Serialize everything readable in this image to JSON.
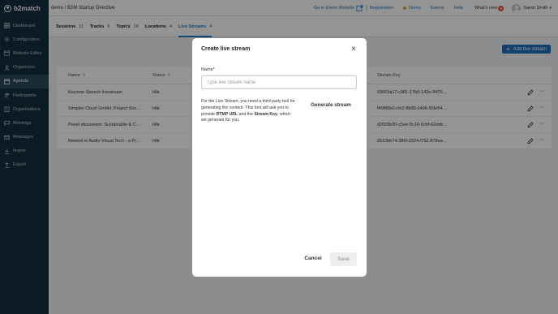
{
  "app": {
    "logo_text": "b2match"
  },
  "sidebar": {
    "items": [
      {
        "label": "Dashboard",
        "icon": "dashboard-icon",
        "active": false
      },
      {
        "label": "Configuration",
        "icon": "configuration-icon",
        "active": false
      },
      {
        "label": "Website Editor",
        "icon": "website-editor-icon",
        "active": false
      },
      {
        "label": "Organizers",
        "icon": "organizers-icon",
        "active": false
      },
      {
        "label": "Agenda",
        "icon": "agenda-icon",
        "active": true
      },
      {
        "label": "Participants",
        "icon": "participants-icon",
        "active": false
      },
      {
        "label": "Organisations",
        "icon": "organisations-icon",
        "active": false
      },
      {
        "label": "Meetings",
        "icon": "meetings-icon",
        "active": false
      },
      {
        "label": "Messages",
        "icon": "messages-icon",
        "active": false
      },
      {
        "label": "Import",
        "icon": "import-icon",
        "active": false
      },
      {
        "label": "Export",
        "icon": "export-icon",
        "active": false
      }
    ]
  },
  "header": {
    "breadcrumb": "demo / B2M Startup Directive",
    "goto_website": "Go to Event Website",
    "separator": "|",
    "registration": "Registration",
    "demo": "Demo",
    "events": "Events",
    "help": "Help",
    "whats_new": "What's new",
    "whats_new_count": "8",
    "user_name": "Sarah Smith",
    "caret": "▾"
  },
  "tabs": [
    {
      "label": "Sessions",
      "count": "11",
      "active": false
    },
    {
      "label": "Tracks",
      "count": "6",
      "active": false
    },
    {
      "label": "Topics",
      "count": "10",
      "active": false
    },
    {
      "label": "Locations",
      "count": "4",
      "active": false
    },
    {
      "label": "Live Streams",
      "count": "4",
      "active": true
    }
  ],
  "main": {
    "add_button": "Add live stream",
    "add_button_plus": "+",
    "columns": {
      "name": "Name",
      "status": "Status",
      "stream_key": "Stream Key"
    },
    "sort_glyph": "⇅",
    "more_glyph": "···",
    "rows": [
      {
        "name": "Keynote Speech livestream",
        "status": "Idle",
        "stream_key": "63663a17-c981-17b0-142e-947529..."
      },
      {
        "name": "Simplex Cloud GmbH: Project Show...",
        "status": "Idle",
        "stream_key": "f40f95b0-cfe2-8b99-0406-6f3e54e4..."
      },
      {
        "name": "Panel discussion: Sustainable & Co...",
        "status": "Idle",
        "stream_key": "d2658b90-c5ee-5c18-6cbf-62ebb80..."
      },
      {
        "name": "Newest in Audio Visual Tech - a Proj...",
        "status": "Idle",
        "stream_key": "6510bb74-386f-2324-f752-878eaaf..."
      }
    ]
  },
  "modal": {
    "title": "Create live stream",
    "close": "×",
    "name_label": "Name*",
    "name_placeholder": "Type live stream name",
    "name_value": "",
    "desc_1": "For the Live Stream, you need a third party tool for generating the content. This tool will ask you to provide ",
    "desc_rtmp": "RTMP URL",
    "desc_2": " and the ",
    "desc_key": "Stream Key",
    "desc_3": ", which we generate for you.",
    "generate_button": "Generate stream",
    "cancel_button": "Cancel",
    "save_button": "Save"
  },
  "colors": {
    "sidebar_bg": "#14303f",
    "accent": "#1f7ac5",
    "primary_button": "#1d6fb8",
    "badge": "#e8523c",
    "demo_dot": "#f0a23a"
  }
}
